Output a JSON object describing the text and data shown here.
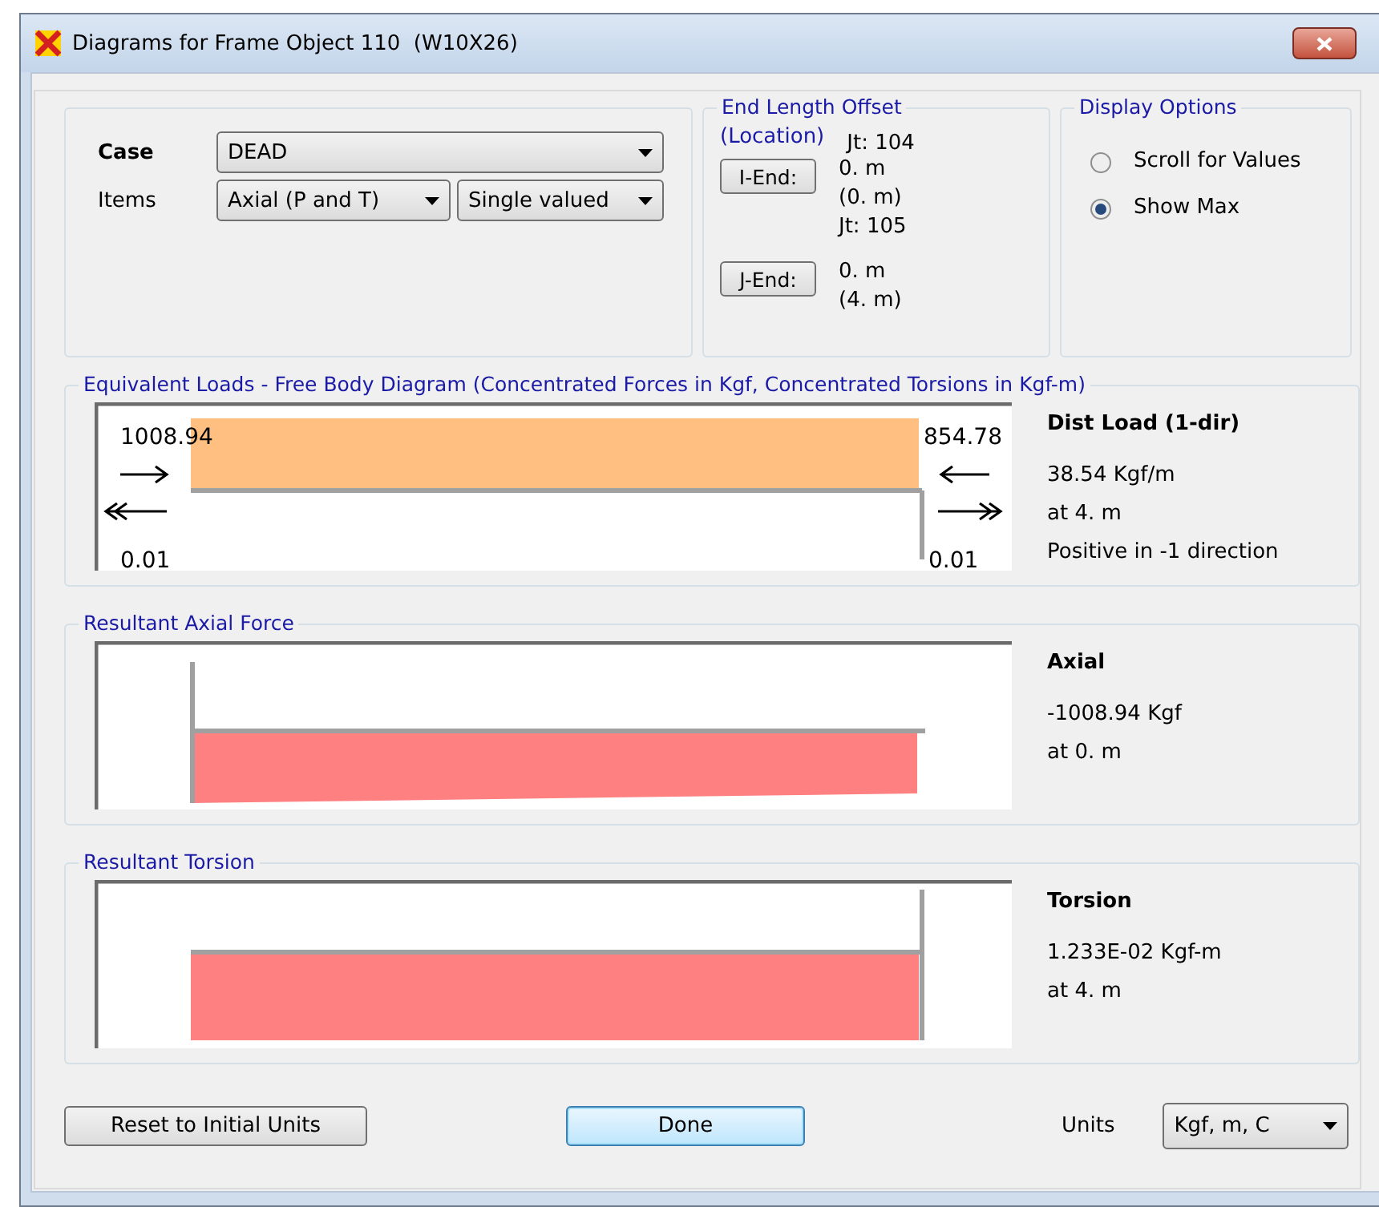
{
  "window": {
    "title": "Diagrams for Frame Object 110  (W10X26)"
  },
  "case": {
    "label": "Case",
    "value": "DEAD"
  },
  "items": {
    "label": "Items",
    "component": "Axial (P and T)",
    "mode": "Single valued"
  },
  "end_length_offset": {
    "title": "End Length Offset",
    "subtitle": "(Location)",
    "joint_top": "Jt:  104",
    "ends": [
      {
        "button": "I-End:",
        "offset": "0. m",
        "location": "(0. m)",
        "joint_after": "Jt:  105"
      },
      {
        "button": "J-End:",
        "offset": "0. m",
        "location": "(4. m)"
      }
    ]
  },
  "display_options": {
    "title": "Display Options",
    "options": [
      {
        "label": "Scroll for Values",
        "selected": false
      },
      {
        "label": "Show Max",
        "selected": true
      }
    ]
  },
  "panels": [
    {
      "kind": "loads",
      "title": "Equivalent Loads - Free Body Diagram  (Concentrated Forces in Kgf, Concentrated Torsions in Kgf-m)",
      "left_force": "1008.94",
      "right_force": "854.78",
      "left_torsion": "0.01",
      "right_torsion": "0.01",
      "info_title": "Dist Load (1-dir)",
      "info_lines": [
        "38.54 Kgf/m",
        "at 4. m",
        "Positive in -1 direction"
      ]
    },
    {
      "kind": "axial",
      "title": "Resultant Axial Force",
      "info_title": "Axial",
      "info_lines": [
        "-1008.94 Kgf",
        "at 0. m"
      ]
    },
    {
      "kind": "torsion",
      "title": "Resultant Torsion",
      "info_title": "Torsion",
      "info_lines": [
        "1.233E-02 Kgf-m",
        "at 4. m"
      ]
    }
  ],
  "buttons": {
    "reset": "Reset to Initial Units",
    "done": "Done"
  },
  "units": {
    "label": "Units",
    "value": "Kgf, m, C"
  }
}
